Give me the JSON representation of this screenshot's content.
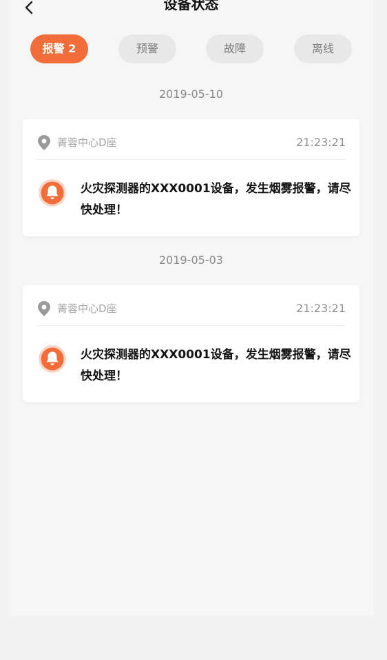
{
  "nav": {
    "title": "设备状态",
    "back_icon": "chevron-left-icon"
  },
  "tabs": [
    {
      "label": "报警 2",
      "active": true
    },
    {
      "label": "预警",
      "active": false
    },
    {
      "label": "故障",
      "active": false
    },
    {
      "label": "离线",
      "active": false
    }
  ],
  "groups": [
    {
      "date": "2019-05-10",
      "card": {
        "location": "菁蓉中心D座",
        "time": "21:23:21",
        "message": "火灾探测器的XXX0001设备，发生烟雾报警，请尽快处理！"
      }
    },
    {
      "date": "2019-05-03",
      "card": {
        "location": "菁蓉中心D座",
        "time": "21:23:21",
        "message": "火灾探测器的XXX0001设备，发生烟雾报警，请尽快处理！"
      }
    }
  ],
  "colors": {
    "accent": "#f36d3a",
    "tab_inactive_bg": "#e8e8e8",
    "page_bg": "#f6f6f6"
  },
  "icons": {
    "location": "location-pin-icon",
    "alarm": "bell-icon"
  }
}
